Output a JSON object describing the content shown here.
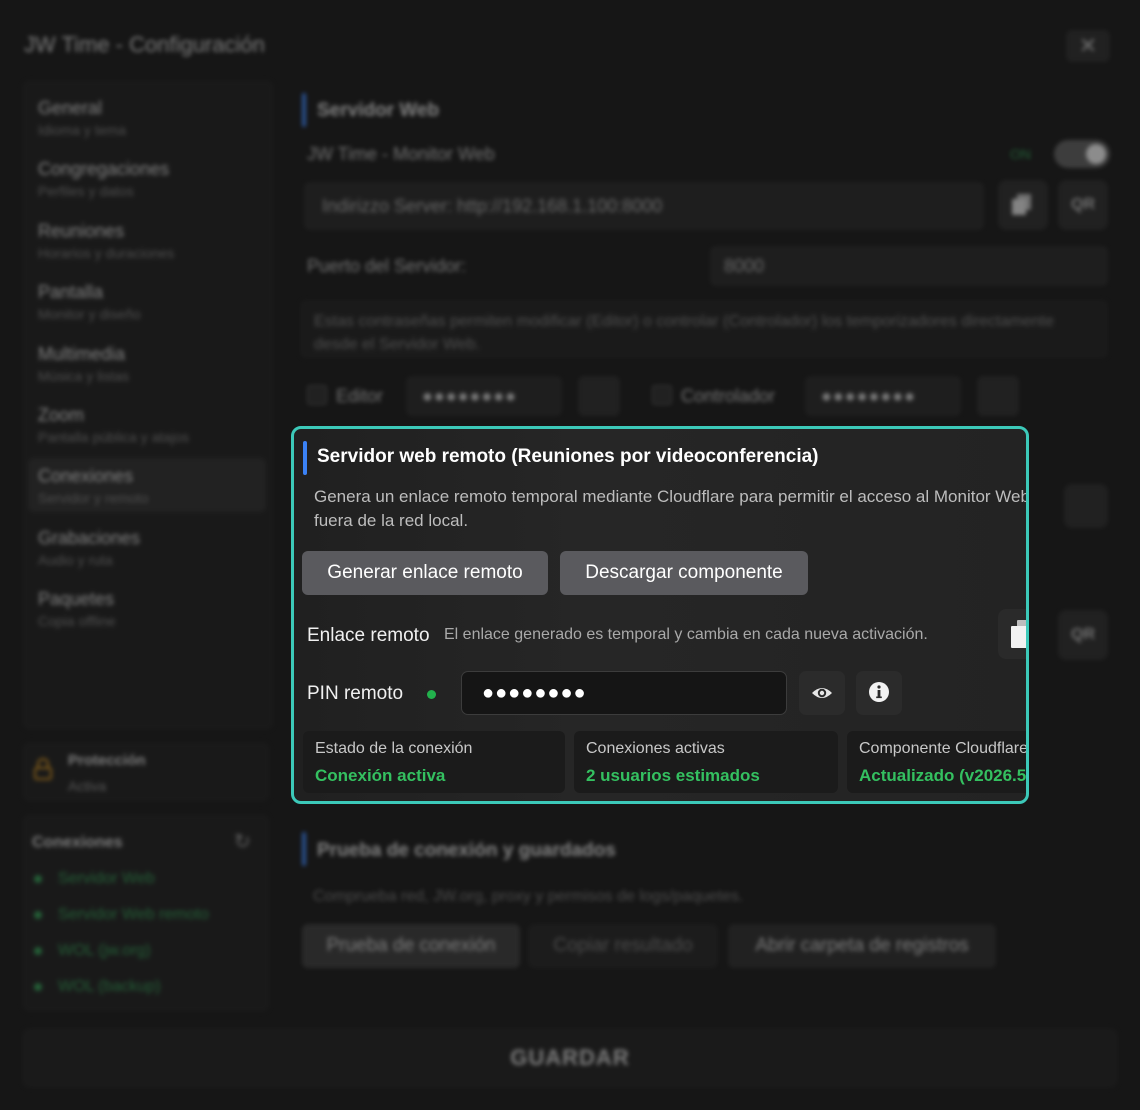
{
  "window": {
    "title": "JW Time - Configuración",
    "close_glyph": "✕"
  },
  "sidebar": {
    "items": [
      {
        "label": "General",
        "sub": "Idioma y tema"
      },
      {
        "label": "Congregaciones",
        "sub": "Perfiles y datos"
      },
      {
        "label": "Reuniones",
        "sub": "Horarios y duraciones"
      },
      {
        "label": "Pantalla",
        "sub": "Monitor y diseño"
      },
      {
        "label": "Multimedia",
        "sub": "Música y listas"
      },
      {
        "label": "Zoom",
        "sub": "Pantalla pública y atajos"
      },
      {
        "label": "Conexiones",
        "sub": "Servidor y remoto"
      },
      {
        "label": "Grabaciones",
        "sub": "Audio y ruta"
      },
      {
        "label": "Paquetes",
        "sub": "Copia offline"
      }
    ],
    "active_index": 6
  },
  "protection": {
    "title": "Protección",
    "status": "Activa"
  },
  "connections": {
    "title": "Conexiones",
    "items": [
      "Servidor Web",
      "Servidor Web remoto",
      "WOL (jw.org)",
      "WOL (backup)"
    ],
    "status_color": "#2f9a52"
  },
  "web_server": {
    "section_title": "Servidor Web",
    "monitor_label": "JW Time - Monitor Web",
    "toggle_label": "ON",
    "address": "Indirizzo Server: http://192.168.1.100:8000",
    "qr_label": "QR",
    "port_label": "Puerto del Servidor:",
    "port_value": "8000",
    "password_note": "Estas contraseñas permiten modificar (Editor) o controlar (Controlador) los temporizadores directamente desde el Servidor Web.",
    "editor_label": "Editor",
    "editor_password": "●●●●●●●●",
    "controller_label": "Controlador",
    "controller_password": "●●●●●●●●"
  },
  "remote": {
    "title": "Servidor web remoto (Reuniones por videoconferencia)",
    "description": "Genera un enlace remoto temporal mediante Cloudflare para permitir el acceso al Monitor Web fuera de la red local.",
    "generate_button": "Generar enlace remoto",
    "download_button": "Descargar componente",
    "link_label": "Enlace remoto",
    "link_hint": "El enlace generado es temporal y cambia en cada nueva activación.",
    "qr_label": "QR",
    "pin_label": "PIN remoto",
    "pin_value": "●●●●●●●●",
    "stats": [
      {
        "key": "Estado de la conexión",
        "value": "Conexión activa"
      },
      {
        "key": "Conexiones activas",
        "value": "2 usuarios estimados"
      },
      {
        "key": "Componente Cloudflare",
        "value": "Actualizado (v2026.5"
      }
    ],
    "accent_color": "#3cc9b9",
    "ok_color": "#34c060"
  },
  "test": {
    "section_title": "Prueba de conexión y guardados",
    "description": "Comprueba red, JW.org, proxy y permisos de logs/paquetes.",
    "buttons": [
      "Prueba de conexión",
      "Copiar resultado",
      "Abrir carpeta de registros"
    ]
  },
  "save_button": "GUARDAR"
}
